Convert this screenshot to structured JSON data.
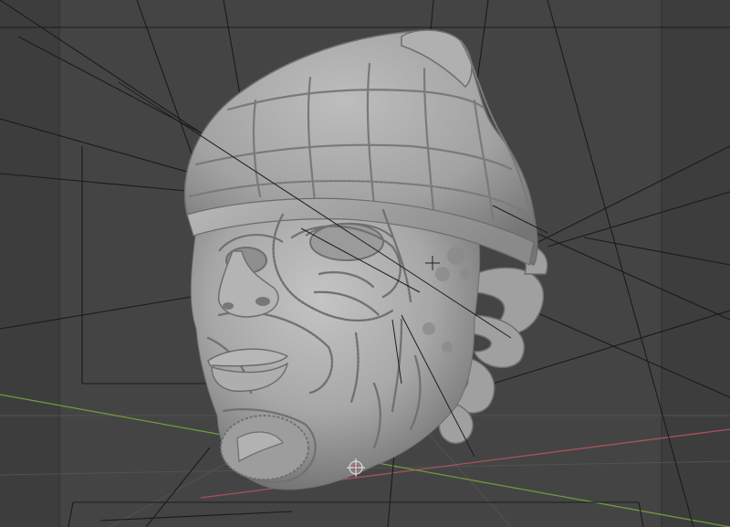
{
  "viewport": {
    "background_color": "#3d3d3d",
    "camera_region_color": "#444444",
    "grid_line_color": "#535353",
    "x_axis_color": "#a8525b",
    "y_axis_color": "#6f9a3b",
    "wire_line_color": "#1a1a1a",
    "sculpt_color": "#a9a9a9",
    "object_origin_icon": "origin-crosshair-icon",
    "scene_object": "sculpted-head-mesh"
  }
}
